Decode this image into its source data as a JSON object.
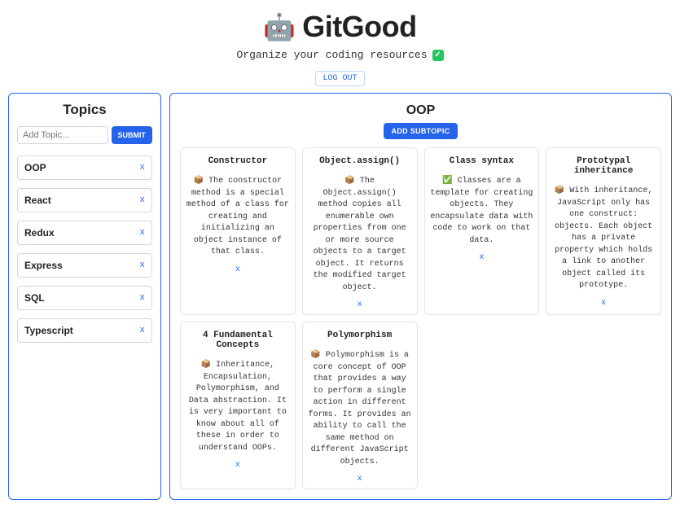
{
  "brand": {
    "icon": "🤖",
    "title": "GitGood",
    "tagline": "Organize your coding resources",
    "check_icon": "✓"
  },
  "logout_label": "LOG OUT",
  "sidebar": {
    "title": "Topics",
    "input_placeholder": "Add Topic...",
    "submit_label": "SUBMIT",
    "items": [
      {
        "label": "OOP",
        "close": "x"
      },
      {
        "label": "React",
        "close": "x"
      },
      {
        "label": "Redux",
        "close": "x"
      },
      {
        "label": "Express",
        "close": "x"
      },
      {
        "label": "SQL",
        "close": "x"
      },
      {
        "label": "Typescript",
        "close": "x"
      }
    ]
  },
  "content": {
    "title": "OOP",
    "add_subtopic_label": "ADD SUBTOPIC",
    "cards": [
      {
        "title": "Constructor",
        "icon": "📦",
        "icon_name": "box-icon",
        "body": "The constructor method is a special method of a class for creating and initializing an object instance of that class.",
        "close": "x"
      },
      {
        "title": "Object.assign()",
        "icon": "📦",
        "icon_name": "box-icon",
        "body": "The Object.assign() method copies all enumerable own properties from one or more source objects to a target object. It returns the modified target object.",
        "close": "x"
      },
      {
        "title": "Class syntax",
        "icon": "✅",
        "icon_name": "check-icon",
        "body": "Classes are a template for creating objects. They encapsulate data with code to work on that data.",
        "close": "x"
      },
      {
        "title": "Prototypal inheritance",
        "icon": "📦",
        "icon_name": "box-icon",
        "body": "With inheritance, JavaScript only has one construct: objects. Each object has a private property which holds a link to another object called its prototype.",
        "close": "x"
      },
      {
        "title": "4 Fundamental Concepts",
        "icon": "📦",
        "icon_name": "box-icon",
        "body": "Inheritance, Encapsulation, Polymorphism, and Data abstraction. It is very important to know about all of these in order to understand OOPs.",
        "close": "x"
      },
      {
        "title": "Polymorphism",
        "icon": "📦",
        "icon_name": "box-icon",
        "body": "Polymorphism is a core concept of OOP that provides a way to perform a single action in different forms. It provides an ability to call the same method on different JavaScript objects.",
        "close": "x"
      }
    ]
  }
}
